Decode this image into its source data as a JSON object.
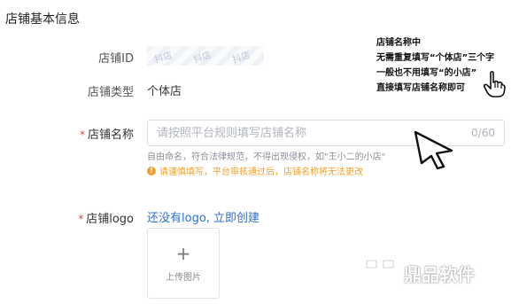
{
  "section": {
    "title": "店铺基本信息"
  },
  "store_id": {
    "label": "店铺ID",
    "watermark": [
      "抖店",
      "抖店",
      "抖店"
    ]
  },
  "store_type": {
    "label": "店铺类型",
    "value": "个体店"
  },
  "store_name": {
    "required_mark": "*",
    "label": "店铺名称",
    "placeholder": "请按照平台规则填写店铺名称",
    "value": "",
    "counter": "0/60",
    "hint": "自由命名，符合法律规范，不得出现侵权，如\"王小二的小店\"",
    "warning": "请谨慎填写，平台审核通过后，店铺名称将无法更改",
    "warning_icon": "!"
  },
  "store_logo": {
    "required_mark": "*",
    "label": "店铺logo",
    "link": "还没有logo, 立即创建",
    "upload_plus": "+",
    "upload_label": "上传图片"
  },
  "annotation": {
    "lines": [
      "店铺名称中",
      "无需重复填写“个体店”三个字",
      "一般也不用填写“的小店”",
      "直接填写店铺名称即可"
    ]
  },
  "brand": {
    "name": "鼎品软件",
    "logo_icon": "brand-logo-icon"
  },
  "colors": {
    "accent_link": "#2d6fd6",
    "warning": "#f0a030",
    "required": "#e8414a"
  }
}
